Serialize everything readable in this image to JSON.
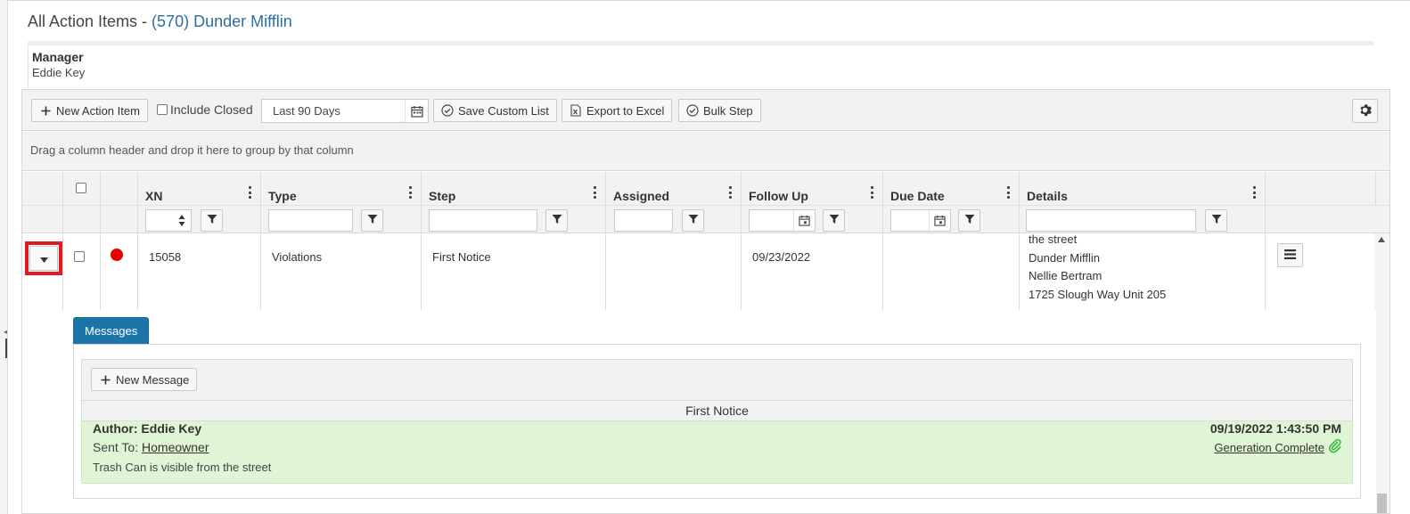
{
  "header": {
    "title_prefix": "All Action Items - ",
    "org_link": "(570) Dunder Mifflin"
  },
  "manager": {
    "label": "Manager",
    "name": "Eddie Key"
  },
  "toolbar": {
    "new_action_item": "New Action Item",
    "include_closed": "Include Closed",
    "date_range": "Last 90 Days",
    "save_custom_list": "Save Custom List",
    "export_excel": "Export to Excel",
    "bulk_step": "Bulk Step"
  },
  "group_hint": "Drag a column header and drop it here to group by that column",
  "columns": {
    "xn": "XN",
    "type": "Type",
    "step": "Step",
    "assigned": "Assigned",
    "follow_up": "Follow Up",
    "due_date": "Due Date",
    "details": "Details"
  },
  "row": {
    "xn": "15058",
    "type": "Violations",
    "step": "First Notice",
    "assigned": "",
    "follow_up": "09/23/2022",
    "due_date": "",
    "details": [
      "the street",
      "Dunder Mifflin",
      "Nellie Bertram",
      "1725 Slough Way Unit 205"
    ],
    "status_color": "#e60000"
  },
  "detail": {
    "tab_label": "Messages",
    "new_message": "New Message",
    "message_heading": "First Notice",
    "author": "Author: Eddie Key",
    "sent_to_prefix": "Sent To: ",
    "sent_to": "Homeowner",
    "body": "Trash Can is visible from the street",
    "datetime": "09/19/2022 1:43:50 PM",
    "generation_status": "Generation Complete"
  },
  "colors": {
    "accent": "#1b75a9",
    "link": "#2e6da4",
    "highlight": "#e01b24",
    "message_bg": "#dff5d5",
    "paperclip": "#3cb83c"
  }
}
